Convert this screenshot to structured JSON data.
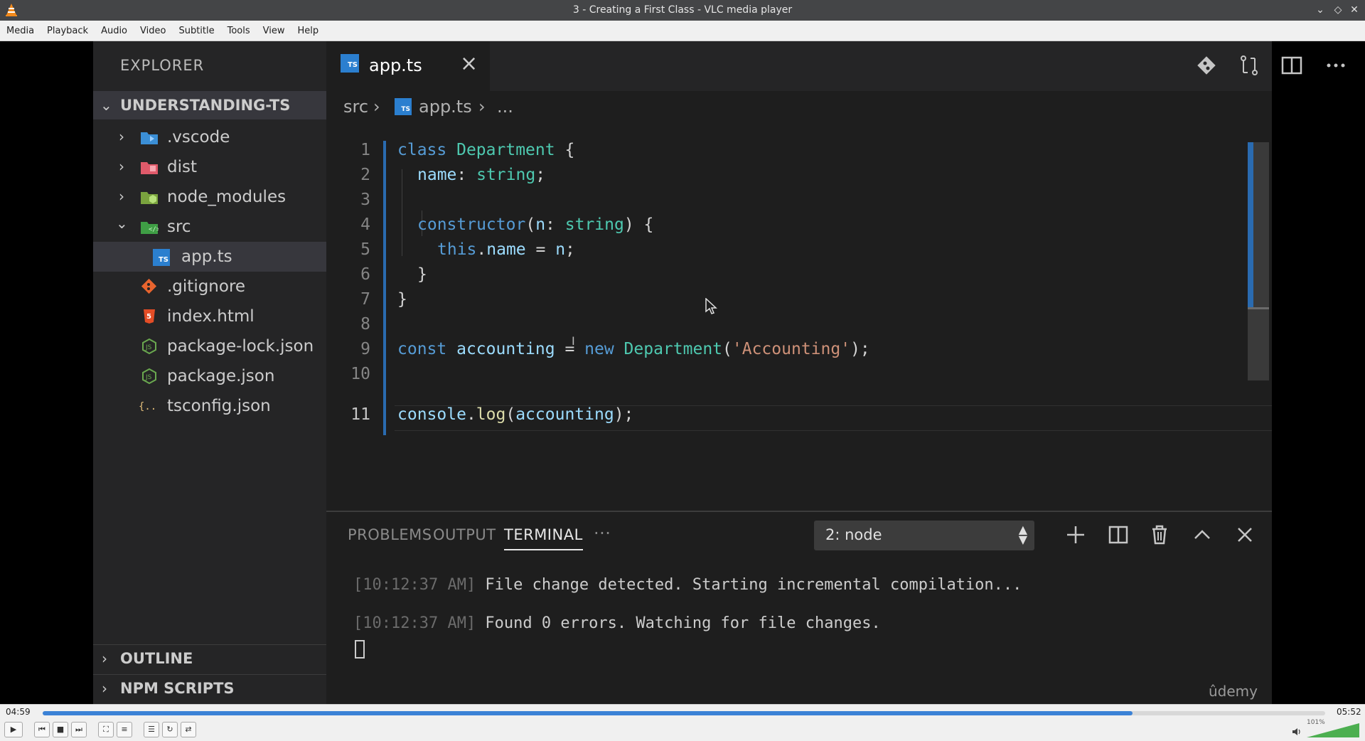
{
  "window": {
    "title": "3 - Creating a First Class - VLC media player"
  },
  "menu": [
    "Media",
    "Playback",
    "Audio",
    "Video",
    "Subtitle",
    "Tools",
    "View",
    "Help"
  ],
  "explorer": {
    "header": "EXPLORER",
    "project": "UNDERSTANDING-TS",
    "items": [
      {
        "label": ".vscode",
        "icon": "vscode-folder-icon",
        "color": "#3b8fd6"
      },
      {
        "label": "dist",
        "icon": "dist-folder-icon",
        "color": "#e05a6a"
      },
      {
        "label": "node_modules",
        "icon": "node-folder-icon",
        "color": "#8bc34a"
      },
      {
        "label": "src",
        "icon": "src-folder-icon",
        "color": "#4caf50"
      },
      {
        "label": "app.ts",
        "icon": "typescript-file-icon",
        "color": "#2b7fcf"
      },
      {
        "label": ".gitignore",
        "icon": "git-icon",
        "color": "#e8642e"
      },
      {
        "label": "index.html",
        "icon": "html5-icon",
        "color": "#e44d26"
      },
      {
        "label": "package-lock.json",
        "icon": "nodejs-icon",
        "color": "#6aa84f"
      },
      {
        "label": "package.json",
        "icon": "nodejs-icon",
        "color": "#6aa84f"
      },
      {
        "label": "tsconfig.json",
        "icon": "json-icon",
        "color": "#e5c07b"
      }
    ],
    "outline": "OUTLINE",
    "npm_scripts": "NPM SCRIPTS"
  },
  "editor": {
    "tab_label": "app.ts",
    "ts_badge": "TS",
    "breadcrumb": {
      "folder": "src",
      "file": "app.ts",
      "more": "..."
    },
    "line_numbers": [
      "1",
      "2",
      "3",
      "4",
      "5",
      "6",
      "7",
      "8",
      "9",
      "10",
      "11"
    ],
    "code": {
      "l1_kw": "class",
      "l1_name": "Department",
      "l1_rest": " {",
      "l2_prop": "name",
      "l2_colon": ": ",
      "l2_type": "string",
      "l2_end": ";",
      "l4_fn": "constructor",
      "l4_open": "(",
      "l4_param": "n",
      "l4_colon": ": ",
      "l4_type": "string",
      "l4_close": ") {",
      "l5_this": "this",
      "l5_dot": ".",
      "l5_prop": "name",
      "l5_eq": " = ",
      "l5_val": "n",
      "l5_end": ";",
      "l6": "}",
      "l7": "}",
      "l9_kw": "const",
      "l9_var": "accounting",
      "l9_eq": " = ",
      "l9_new": "new",
      "l9_cls": "Department",
      "l9_open": "(",
      "l9_str": "'Accounting'",
      "l9_close": ");",
      "l11_obj": "console",
      "l11_dot": ".",
      "l11_fn": "log",
      "l11_open": "(",
      "l11_arg": "accounting",
      "l11_close": ");"
    }
  },
  "panel": {
    "tabs": [
      "PROBLEMS",
      "OUTPUT",
      "TERMINAL",
      "···"
    ],
    "active_tab": "TERMINAL",
    "terminal_select": "2: node",
    "lines": [
      {
        "ts": "[10:12:37 AM]",
        "text": " File change detected. Starting incremental compilation..."
      },
      {
        "ts": "[10:12:37 AM]",
        "text": " Found 0 errors. Watching for file changes."
      }
    ],
    "watermark": "ûdemy"
  },
  "player": {
    "elapsed": "04:59",
    "total": "05:52",
    "progress_fraction": 0.85,
    "volume_label": "101%",
    "volume_fraction": 1.0,
    "accent": "#3b82d6"
  }
}
